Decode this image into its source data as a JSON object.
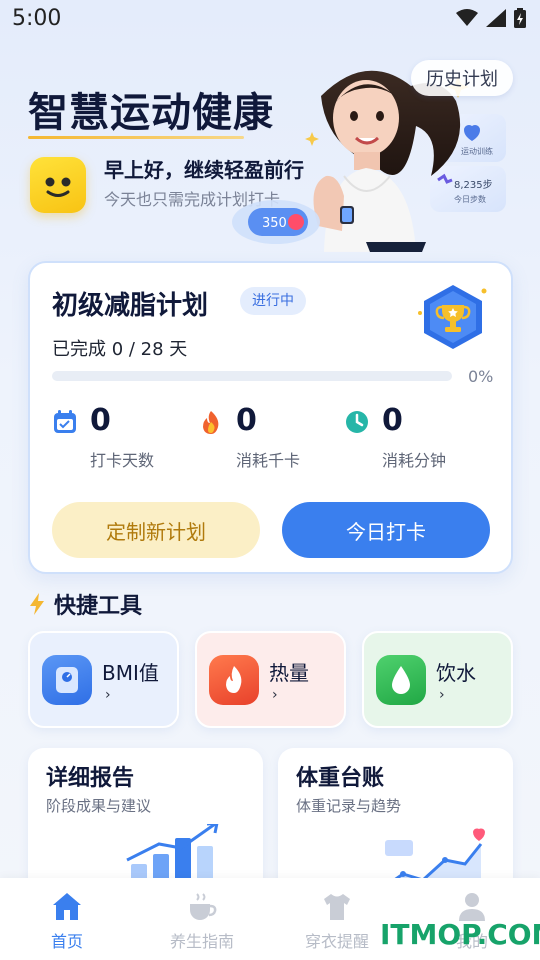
{
  "status_bar": {
    "time": "5:00"
  },
  "hero": {
    "title": "智慧运动健康",
    "greeting": "早上好，继续轻盈前行",
    "subtitle": "今天也只需完成计划打卡",
    "history_button": "历史计划",
    "badge_calorie": "350",
    "card_label_health": "运动训练",
    "card_steps": "8,235步",
    "card_steps_label": "今日步数"
  },
  "plan": {
    "title": "初级减脂计划",
    "status": "进行中",
    "progress_text": "已完成 0 / 28 天",
    "progress_percent": "0%",
    "progress_value": 0,
    "stats": [
      {
        "value": "0",
        "label": "打卡天数",
        "icon": "calendar-check-icon"
      },
      {
        "value": "0",
        "label": "消耗千卡",
        "icon": "fire-icon"
      },
      {
        "value": "0",
        "label": "消耗分钟",
        "icon": "clock-icon"
      }
    ],
    "btn_custom": "定制新计划",
    "btn_checkin": "今日打卡"
  },
  "tools": {
    "title": "快捷工具",
    "items": [
      {
        "name": "BMI值",
        "arrow": "›",
        "icon": "scale-icon",
        "color": "#3a7fee"
      },
      {
        "name": "热量",
        "arrow": "›",
        "icon": "flame-icon",
        "color": "#f0522e"
      },
      {
        "name": "饮水",
        "arrow": "›",
        "icon": "water-drop-icon",
        "color": "#29b44e"
      }
    ]
  },
  "reports": [
    {
      "title": "详细报告",
      "subtitle": "阶段成果与建议"
    },
    {
      "title": "体重台账",
      "subtitle": "体重记录与趋势"
    }
  ],
  "nav": {
    "items": [
      {
        "label": "首页",
        "icon": "home-icon",
        "active": true
      },
      {
        "label": "养生指南",
        "icon": "tea-cup-icon",
        "active": false
      },
      {
        "label": "穿衣提醒",
        "icon": "shirt-icon",
        "active": false
      },
      {
        "label": "我的",
        "icon": "user-icon",
        "active": false
      }
    ]
  },
  "watermark": "ITMOP.COM",
  "colors": {
    "accent": "#3a7fee",
    "gold": "#f4b732",
    "brand_green": "#17a36a"
  }
}
